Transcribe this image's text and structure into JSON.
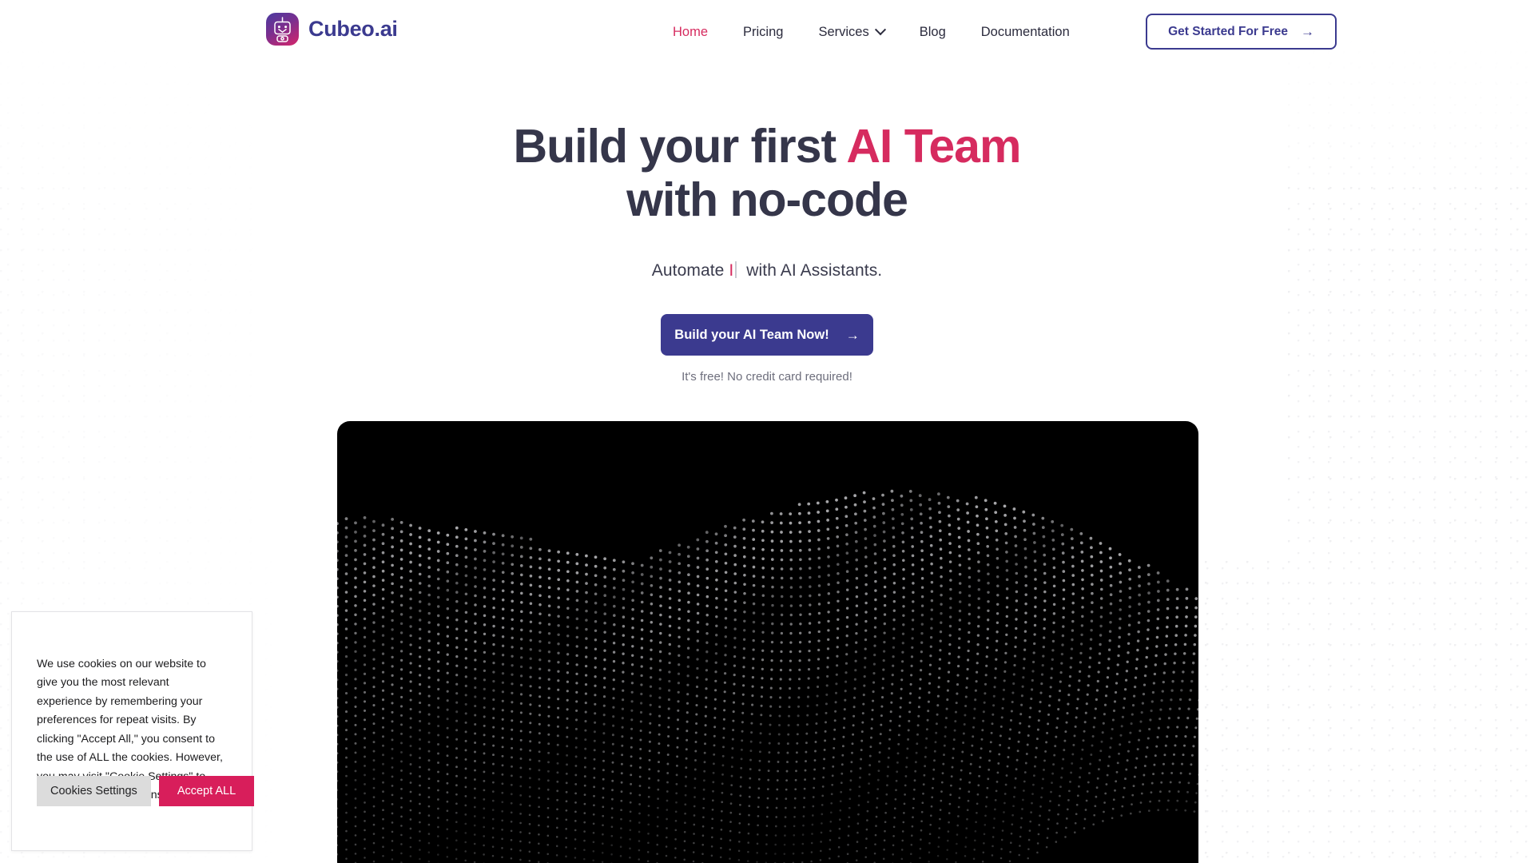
{
  "colors": {
    "brand_indigo": "#3b3a8f",
    "accent_pink": "#d62b5f",
    "cookie_accept": "#d81e5b",
    "heading_dark": "#35364a",
    "hero_bg": "#000000"
  },
  "header": {
    "brand_name": "Cubeo.ai",
    "brand_icon": "robot-logo-icon",
    "nav_items": [
      {
        "label": "Home",
        "active": true,
        "has_chevron": false
      },
      {
        "label": "Pricing",
        "active": false,
        "has_chevron": false
      },
      {
        "label": "Services",
        "active": false,
        "has_chevron": true
      },
      {
        "label": "Blog",
        "active": false,
        "has_chevron": false
      },
      {
        "label": "Documentation",
        "active": false,
        "has_chevron": false
      }
    ],
    "cta": {
      "label": "Get Started For Free",
      "icon": "arrow-right-icon",
      "arrow": "→"
    }
  },
  "hero": {
    "headline_line1_plain": "Build your first ",
    "headline_line1_accent": "AI Team",
    "headline_line2": "with no-code",
    "subline_prefix": "Automate ",
    "subline_typed": "I",
    "subline_suffix": " with AI Assistants.",
    "cta": {
      "label": "Build your AI Team Now!",
      "icon": "arrow-right-icon",
      "arrow": "→"
    },
    "cta_note": "It's free! No credit card required!",
    "image": {
      "name": "dotted-wave-visual",
      "background": "#000000",
      "caption_left": "",
      "caption_right": ""
    }
  },
  "cookie_banner": {
    "body": "We use cookies on our website to give you the most relevant experience by remembering your preferences for repeat visits. By clicking \"Accept All,\" you consent to the use of ALL the cookies. However, you may visit \"Cookie Settings\" to provide a controlled consent.",
    "settings_label": "Cookies Settings",
    "accept_label": "Accept ALL"
  }
}
